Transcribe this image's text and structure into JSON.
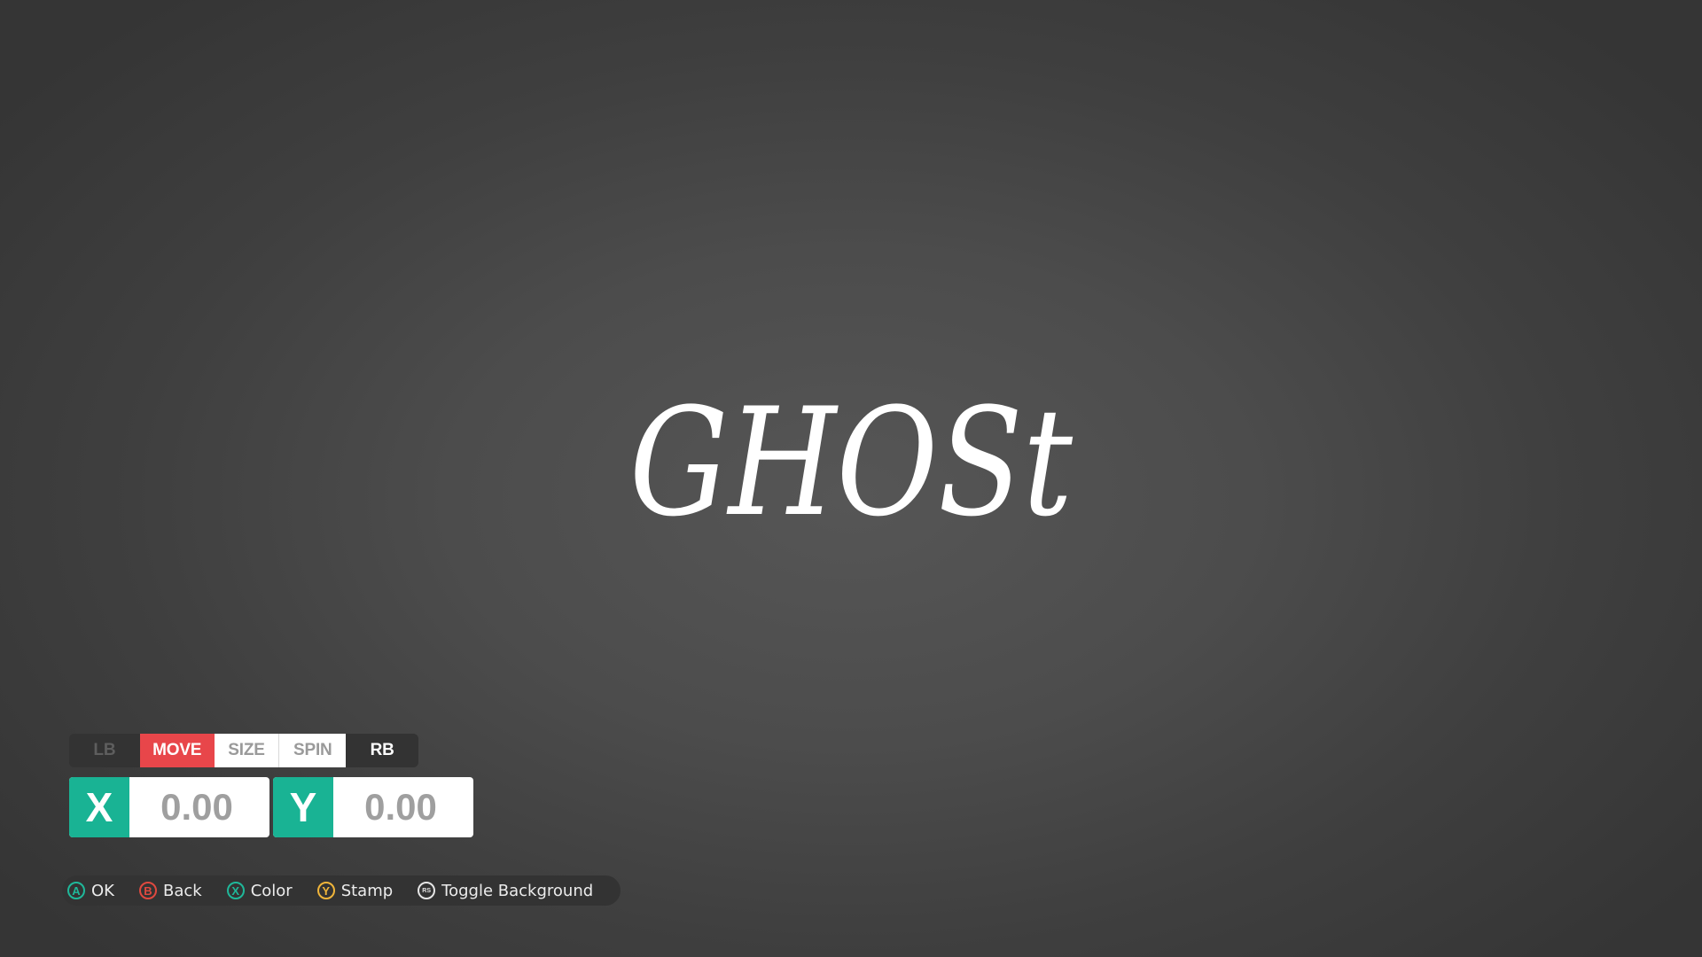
{
  "logo": {
    "text": "GHOSt",
    "color": "#ffffff"
  },
  "mode_tabs": {
    "left_bumper": "LB",
    "tabs": [
      "MOVE",
      "SIZE",
      "SPIN"
    ],
    "active": "MOVE",
    "right_bumper": "RB",
    "active_color": "#e8464a"
  },
  "coordinates": {
    "x": {
      "label": "X",
      "value": "0.00"
    },
    "y": {
      "label": "Y",
      "value": "0.00"
    },
    "accent_color": "#19b394"
  },
  "prompts": [
    {
      "button": "A",
      "label": "OK",
      "color": "#1fb89a",
      "icon": "a-button-icon"
    },
    {
      "button": "B",
      "label": "Back",
      "color": "#e0493f",
      "icon": "b-button-icon"
    },
    {
      "button": "X",
      "label": "Color",
      "color": "#1fb89a",
      "icon": "x-button-icon"
    },
    {
      "button": "Y",
      "label": "Stamp",
      "color": "#f0b53a",
      "icon": "y-button-icon"
    },
    {
      "button": "RS",
      "label": "Toggle Background",
      "color": "#e6e6e6",
      "icon": "right-stick-icon"
    }
  ]
}
